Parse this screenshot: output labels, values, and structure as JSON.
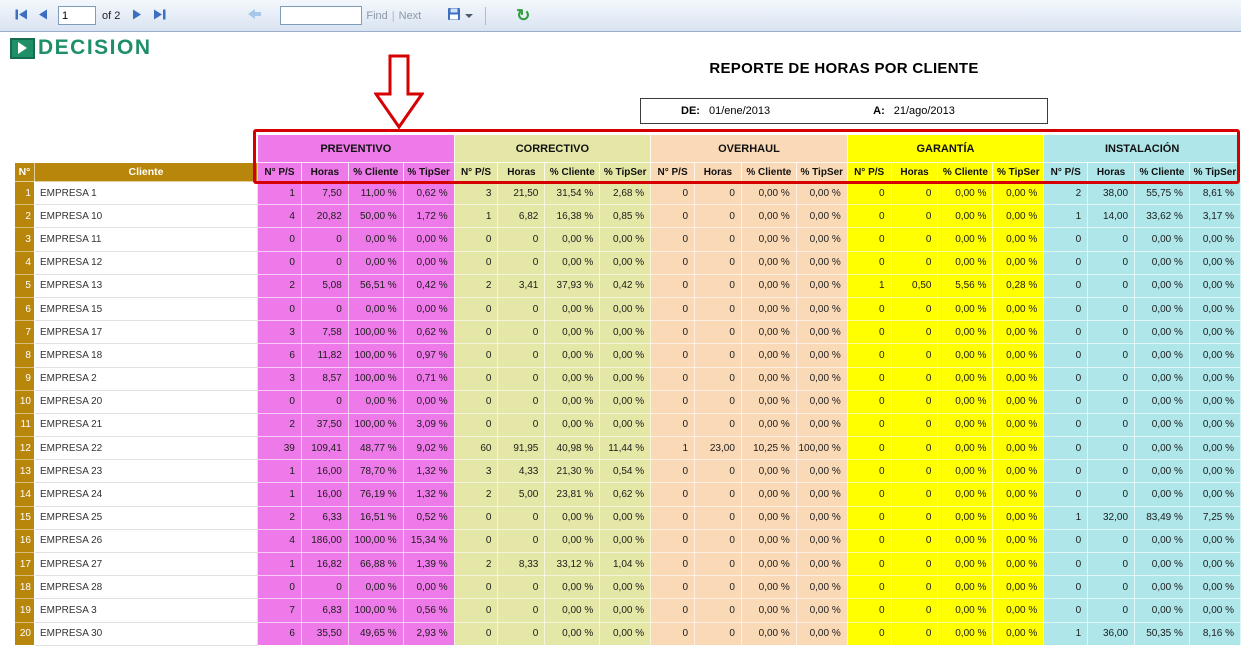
{
  "toolbar": {
    "page_value": "1",
    "of_label": "of 2",
    "find_label": "Find",
    "next_label": "Next",
    "pipe": "|",
    "refresh_glyph": "↻"
  },
  "logo": {
    "text": "DECISION"
  },
  "report": {
    "title": "REPORTE DE HORAS POR CLIENTE",
    "de_label": "DE:",
    "de_value": "01/ene/2013",
    "a_label": "A:",
    "a_value": "21/ago/2013"
  },
  "colors": {
    "header_gold": "#B8860B",
    "annotation_red": "#D60000"
  },
  "table": {
    "corner": {
      "num": "N°",
      "client": "Cliente"
    },
    "sub_headers": [
      "N° P/S",
      "Horas",
      "% Cliente",
      "% TipSer"
    ],
    "groups": [
      {
        "label": "PREVENTIVO",
        "color": "#EE7AE9"
      },
      {
        "label": "CORRECTIVO",
        "color": "#E5E7A6"
      },
      {
        "label": "OVERHAUL",
        "color": "#FAD9B7"
      },
      {
        "label": "GARANTÍA",
        "color": "#FFFF00"
      },
      {
        "label": "INSTALACIÓN",
        "color": "#AEE6E9"
      }
    ],
    "rows": [
      {
        "n": 1,
        "client": "EMPRESA 1",
        "values": [
          [
            "1",
            "7,50",
            "11,00 %",
            "0,62 %"
          ],
          [
            "3",
            "21,50",
            "31,54 %",
            "2,68 %"
          ],
          [
            "0",
            "0",
            "0,00 %",
            "0,00 %"
          ],
          [
            "0",
            "0",
            "0,00 %",
            "0,00 %"
          ],
          [
            "2",
            "38,00",
            "55,75 %",
            "8,61 %"
          ]
        ]
      },
      {
        "n": 2,
        "client": "EMPRESA 10",
        "values": [
          [
            "4",
            "20,82",
            "50,00 %",
            "1,72 %"
          ],
          [
            "1",
            "6,82",
            "16,38 %",
            "0,85 %"
          ],
          [
            "0",
            "0",
            "0,00 %",
            "0,00 %"
          ],
          [
            "0",
            "0",
            "0,00 %",
            "0,00 %"
          ],
          [
            "1",
            "14,00",
            "33,62 %",
            "3,17 %"
          ]
        ]
      },
      {
        "n": 3,
        "client": "EMPRESA 11",
        "values": [
          [
            "0",
            "0",
            "0,00 %",
            "0,00 %"
          ],
          [
            "0",
            "0",
            "0,00 %",
            "0,00 %"
          ],
          [
            "0",
            "0",
            "0,00 %",
            "0,00 %"
          ],
          [
            "0",
            "0",
            "0,00 %",
            "0,00 %"
          ],
          [
            "0",
            "0",
            "0,00 %",
            "0,00 %"
          ]
        ]
      },
      {
        "n": 4,
        "client": "EMPRESA 12",
        "values": [
          [
            "0",
            "0",
            "0,00 %",
            "0,00 %"
          ],
          [
            "0",
            "0",
            "0,00 %",
            "0,00 %"
          ],
          [
            "0",
            "0",
            "0,00 %",
            "0,00 %"
          ],
          [
            "0",
            "0",
            "0,00 %",
            "0,00 %"
          ],
          [
            "0",
            "0",
            "0,00 %",
            "0,00 %"
          ]
        ]
      },
      {
        "n": 5,
        "client": "EMPRESA 13",
        "values": [
          [
            "2",
            "5,08",
            "56,51 %",
            "0,42 %"
          ],
          [
            "2",
            "3,41",
            "37,93 %",
            "0,42 %"
          ],
          [
            "0",
            "0",
            "0,00 %",
            "0,00 %"
          ],
          [
            "1",
            "0,50",
            "5,56 %",
            "0,28 %"
          ],
          [
            "0",
            "0",
            "0,00 %",
            "0,00 %"
          ]
        ]
      },
      {
        "n": 6,
        "client": "EMPRESA 15",
        "values": [
          [
            "0",
            "0",
            "0,00 %",
            "0,00 %"
          ],
          [
            "0",
            "0",
            "0,00 %",
            "0,00 %"
          ],
          [
            "0",
            "0",
            "0,00 %",
            "0,00 %"
          ],
          [
            "0",
            "0",
            "0,00 %",
            "0,00 %"
          ],
          [
            "0",
            "0",
            "0,00 %",
            "0,00 %"
          ]
        ]
      },
      {
        "n": 7,
        "client": "EMPRESA 17",
        "values": [
          [
            "3",
            "7,58",
            "100,00 %",
            "0,62 %"
          ],
          [
            "0",
            "0",
            "0,00 %",
            "0,00 %"
          ],
          [
            "0",
            "0",
            "0,00 %",
            "0,00 %"
          ],
          [
            "0",
            "0",
            "0,00 %",
            "0,00 %"
          ],
          [
            "0",
            "0",
            "0,00 %",
            "0,00 %"
          ]
        ]
      },
      {
        "n": 8,
        "client": "EMPRESA 18",
        "values": [
          [
            "6",
            "11,82",
            "100,00 %",
            "0,97 %"
          ],
          [
            "0",
            "0",
            "0,00 %",
            "0,00 %"
          ],
          [
            "0",
            "0",
            "0,00 %",
            "0,00 %"
          ],
          [
            "0",
            "0",
            "0,00 %",
            "0,00 %"
          ],
          [
            "0",
            "0",
            "0,00 %",
            "0,00 %"
          ]
        ]
      },
      {
        "n": 9,
        "client": "EMPRESA 2",
        "values": [
          [
            "3",
            "8,57",
            "100,00 %",
            "0,71 %"
          ],
          [
            "0",
            "0",
            "0,00 %",
            "0,00 %"
          ],
          [
            "0",
            "0",
            "0,00 %",
            "0,00 %"
          ],
          [
            "0",
            "0",
            "0,00 %",
            "0,00 %"
          ],
          [
            "0",
            "0",
            "0,00 %",
            "0,00 %"
          ]
        ]
      },
      {
        "n": 10,
        "client": "EMPRESA 20",
        "values": [
          [
            "0",
            "0",
            "0,00 %",
            "0,00 %"
          ],
          [
            "0",
            "0",
            "0,00 %",
            "0,00 %"
          ],
          [
            "0",
            "0",
            "0,00 %",
            "0,00 %"
          ],
          [
            "0",
            "0",
            "0,00 %",
            "0,00 %"
          ],
          [
            "0",
            "0",
            "0,00 %",
            "0,00 %"
          ]
        ]
      },
      {
        "n": 11,
        "client": "EMPRESA 21",
        "values": [
          [
            "2",
            "37,50",
            "100,00 %",
            "3,09 %"
          ],
          [
            "0",
            "0",
            "0,00 %",
            "0,00 %"
          ],
          [
            "0",
            "0",
            "0,00 %",
            "0,00 %"
          ],
          [
            "0",
            "0",
            "0,00 %",
            "0,00 %"
          ],
          [
            "0",
            "0",
            "0,00 %",
            "0,00 %"
          ]
        ]
      },
      {
        "n": 12,
        "client": "EMPRESA 22",
        "values": [
          [
            "39",
            "109,41",
            "48,77 %",
            "9,02 %"
          ],
          [
            "60",
            "91,95",
            "40,98 %",
            "11,44 %"
          ],
          [
            "1",
            "23,00",
            "10,25 %",
            "100,00 %"
          ],
          [
            "0",
            "0",
            "0,00 %",
            "0,00 %"
          ],
          [
            "0",
            "0",
            "0,00 %",
            "0,00 %"
          ]
        ]
      },
      {
        "n": 13,
        "client": "EMPRESA 23",
        "values": [
          [
            "1",
            "16,00",
            "78,70 %",
            "1,32 %"
          ],
          [
            "3",
            "4,33",
            "21,30 %",
            "0,54 %"
          ],
          [
            "0",
            "0",
            "0,00 %",
            "0,00 %"
          ],
          [
            "0",
            "0",
            "0,00 %",
            "0,00 %"
          ],
          [
            "0",
            "0",
            "0,00 %",
            "0,00 %"
          ]
        ]
      },
      {
        "n": 14,
        "client": "EMPRESA 24",
        "values": [
          [
            "1",
            "16,00",
            "76,19 %",
            "1,32 %"
          ],
          [
            "2",
            "5,00",
            "23,81 %",
            "0,62 %"
          ],
          [
            "0",
            "0",
            "0,00 %",
            "0,00 %"
          ],
          [
            "0",
            "0",
            "0,00 %",
            "0,00 %"
          ],
          [
            "0",
            "0",
            "0,00 %",
            "0,00 %"
          ]
        ]
      },
      {
        "n": 15,
        "client": "EMPRESA 25",
        "values": [
          [
            "2",
            "6,33",
            "16,51 %",
            "0,52 %"
          ],
          [
            "0",
            "0",
            "0,00 %",
            "0,00 %"
          ],
          [
            "0",
            "0",
            "0,00 %",
            "0,00 %"
          ],
          [
            "0",
            "0",
            "0,00 %",
            "0,00 %"
          ],
          [
            "1",
            "32,00",
            "83,49 %",
            "7,25 %"
          ]
        ]
      },
      {
        "n": 16,
        "client": "EMPRESA 26",
        "values": [
          [
            "4",
            "186,00",
            "100,00 %",
            "15,34 %"
          ],
          [
            "0",
            "0",
            "0,00 %",
            "0,00 %"
          ],
          [
            "0",
            "0",
            "0,00 %",
            "0,00 %"
          ],
          [
            "0",
            "0",
            "0,00 %",
            "0,00 %"
          ],
          [
            "0",
            "0",
            "0,00 %",
            "0,00 %"
          ]
        ]
      },
      {
        "n": 17,
        "client": "EMPRESA 27",
        "values": [
          [
            "1",
            "16,82",
            "66,88 %",
            "1,39 %"
          ],
          [
            "2",
            "8,33",
            "33,12 %",
            "1,04 %"
          ],
          [
            "0",
            "0",
            "0,00 %",
            "0,00 %"
          ],
          [
            "0",
            "0",
            "0,00 %",
            "0,00 %"
          ],
          [
            "0",
            "0",
            "0,00 %",
            "0,00 %"
          ]
        ]
      },
      {
        "n": 18,
        "client": "EMPRESA 28",
        "values": [
          [
            "0",
            "0",
            "0,00 %",
            "0,00 %"
          ],
          [
            "0",
            "0",
            "0,00 %",
            "0,00 %"
          ],
          [
            "0",
            "0",
            "0,00 %",
            "0,00 %"
          ],
          [
            "0",
            "0",
            "0,00 %",
            "0,00 %"
          ],
          [
            "0",
            "0",
            "0,00 %",
            "0,00 %"
          ]
        ]
      },
      {
        "n": 19,
        "client": "EMPRESA 3",
        "values": [
          [
            "7",
            "6,83",
            "100,00 %",
            "0,56 %"
          ],
          [
            "0",
            "0",
            "0,00 %",
            "0,00 %"
          ],
          [
            "0",
            "0",
            "0,00 %",
            "0,00 %"
          ],
          [
            "0",
            "0",
            "0,00 %",
            "0,00 %"
          ],
          [
            "0",
            "0",
            "0,00 %",
            "0,00 %"
          ]
        ]
      },
      {
        "n": 20,
        "client": "EMPRESA 30",
        "values": [
          [
            "6",
            "35,50",
            "49,65 %",
            "2,93 %"
          ],
          [
            "0",
            "0",
            "0,00 %",
            "0,00 %"
          ],
          [
            "0",
            "0",
            "0,00 %",
            "0,00 %"
          ],
          [
            "0",
            "0",
            "0,00 %",
            "0,00 %"
          ],
          [
            "1",
            "36,00",
            "50,35 %",
            "8,16 %"
          ]
        ]
      }
    ]
  }
}
